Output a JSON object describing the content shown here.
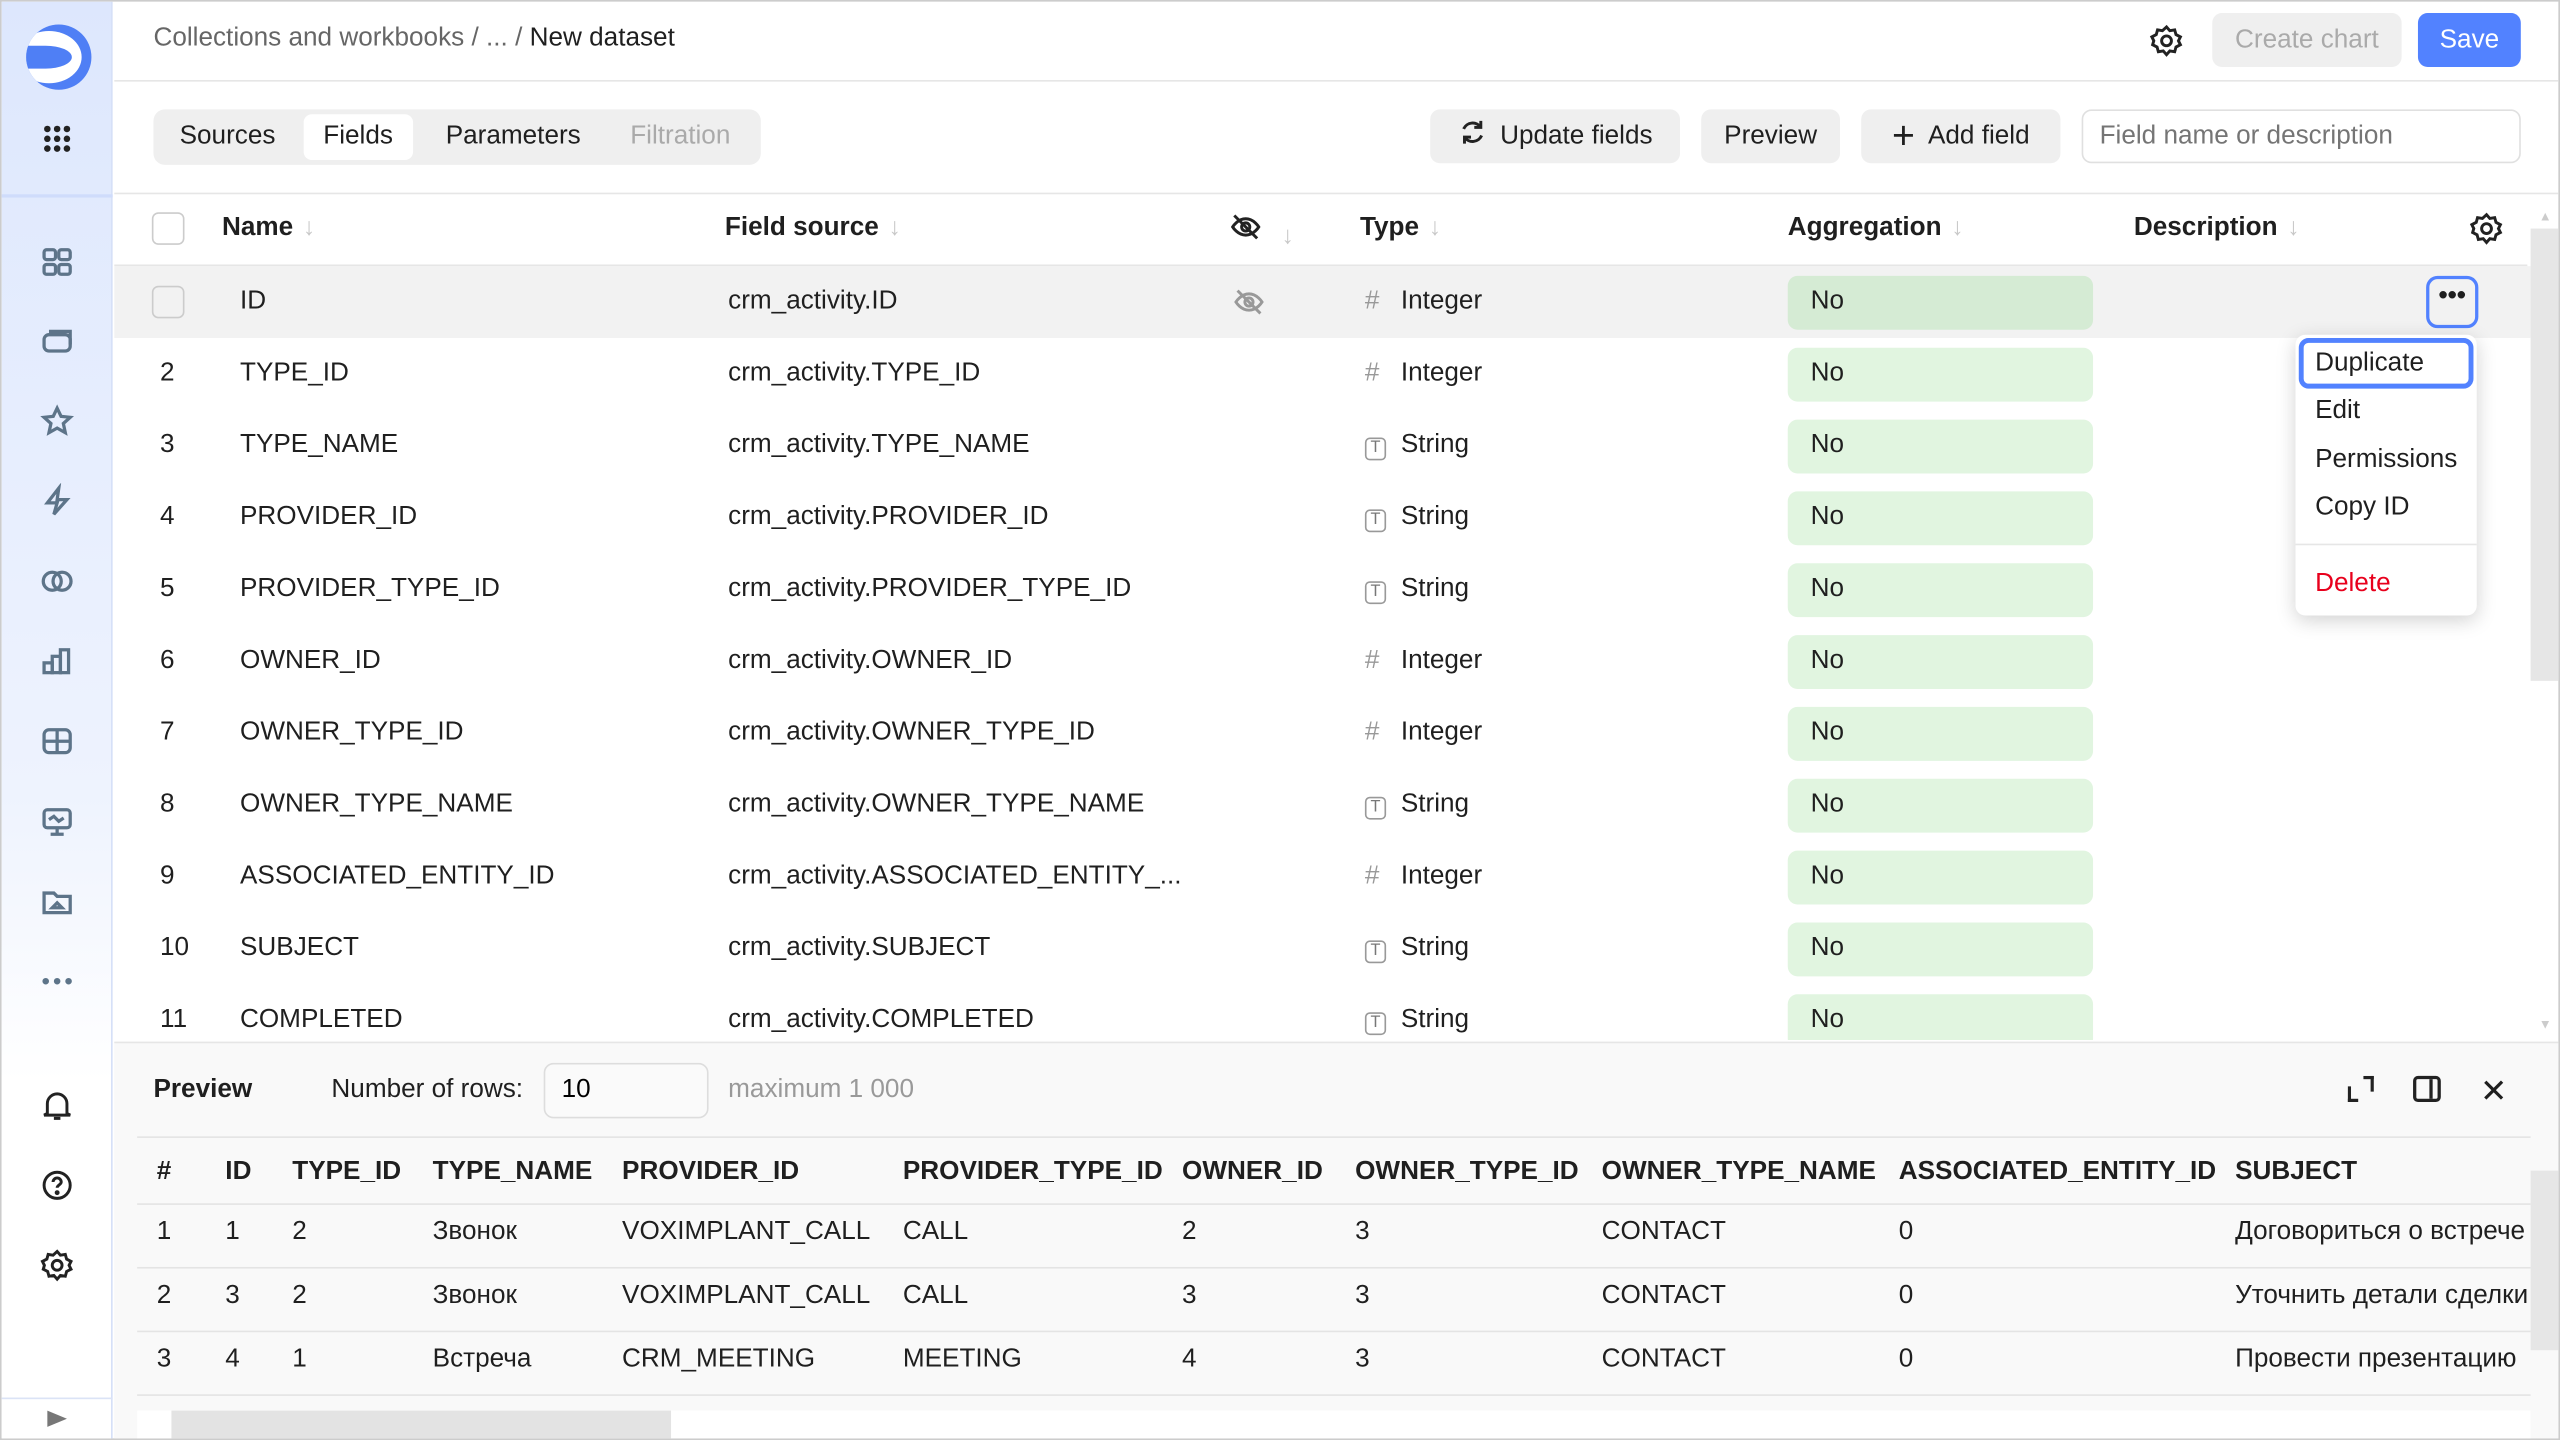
{
  "header": {
    "breadcrumb_root": "Collections and workbooks",
    "breadcrumb_sep1": "/",
    "breadcrumb_ellipsis": "...",
    "breadcrumb_sep2": "/",
    "breadcrumb_current": "New dataset",
    "create_chart": "Create chart",
    "save": "Save"
  },
  "tabs": [
    {
      "label": "Sources"
    },
    {
      "label": "Fields",
      "active": true
    },
    {
      "label": "Parameters"
    },
    {
      "label": "Filtration",
      "disabled": true
    }
  ],
  "toolbar": {
    "update_fields": "Update fields",
    "preview": "Preview",
    "add_field": "Add field",
    "search_placeholder": "Field name or description"
  },
  "table": {
    "columns": {
      "name": "Name",
      "source": "Field source",
      "type": "Type",
      "aggregation": "Aggregation",
      "description": "Description"
    },
    "rows": [
      {
        "num": "",
        "name": "ID",
        "source": "crm_activity.ID",
        "type": "Integer",
        "agg": "No"
      },
      {
        "num": "2",
        "name": "TYPE_ID",
        "source": "crm_activity.TYPE_ID",
        "type": "Integer",
        "agg": "No"
      },
      {
        "num": "3",
        "name": "TYPE_NAME",
        "source": "crm_activity.TYPE_NAME",
        "type": "String",
        "agg": "No"
      },
      {
        "num": "4",
        "name": "PROVIDER_ID",
        "source": "crm_activity.PROVIDER_ID",
        "type": "String",
        "agg": "No"
      },
      {
        "num": "5",
        "name": "PROVIDER_TYPE_ID",
        "source": "crm_activity.PROVIDER_TYPE_ID",
        "type": "String",
        "agg": "No"
      },
      {
        "num": "6",
        "name": "OWNER_ID",
        "source": "crm_activity.OWNER_ID",
        "type": "Integer",
        "agg": "No"
      },
      {
        "num": "7",
        "name": "OWNER_TYPE_ID",
        "source": "crm_activity.OWNER_TYPE_ID",
        "type": "Integer",
        "agg": "No"
      },
      {
        "num": "8",
        "name": "OWNER_TYPE_NAME",
        "source": "crm_activity.OWNER_TYPE_NAME",
        "type": "String",
        "agg": "No"
      },
      {
        "num": "9",
        "name": "ASSOCIATED_ENTITY_ID",
        "source": "crm_activity.ASSOCIATED_ENTITY_...",
        "type": "Integer",
        "agg": "No"
      },
      {
        "num": "10",
        "name": "SUBJECT",
        "source": "crm_activity.SUBJECT",
        "type": "String",
        "agg": "No"
      },
      {
        "num": "11",
        "name": "COMPLETED",
        "source": "crm_activity.COMPLETED",
        "type": "String",
        "agg": "No"
      }
    ]
  },
  "context_menu": {
    "items": [
      "Duplicate",
      "Edit",
      "Permissions",
      "Copy ID"
    ],
    "delete": "Delete"
  },
  "preview": {
    "title": "Preview",
    "rows_label": "Number of rows:",
    "rows_value": "10",
    "max_hint": "maximum 1 000",
    "columns": [
      "#",
      "ID",
      "TYPE_ID",
      "TYPE_NAME",
      "PROVIDER_ID",
      "PROVIDER_TYPE_ID",
      "OWNER_ID",
      "OWNER_TYPE_ID",
      "OWNER_TYPE_NAME",
      "ASSOCIATED_ENTITY_ID",
      "SUBJECT"
    ],
    "rows": [
      [
        "1",
        "1",
        "2",
        "Звонок",
        "VOXIMPLANT_CALL",
        "CALL",
        "2",
        "3",
        "CONTACT",
        "0",
        "Договориться о встрече"
      ],
      [
        "2",
        "3",
        "2",
        "Звонок",
        "VOXIMPLANT_CALL",
        "CALL",
        "3",
        "3",
        "CONTACT",
        "0",
        "Уточнить детали сделки"
      ],
      [
        "3",
        "4",
        "1",
        "Встреча",
        "CRM_MEETING",
        "MEETING",
        "4",
        "3",
        "CONTACT",
        "0",
        "Провести презентацию"
      ]
    ]
  },
  "colors": {
    "accent": "#5282ff",
    "agg_bg": "#e1f5e0",
    "delete": "#e8001c"
  }
}
